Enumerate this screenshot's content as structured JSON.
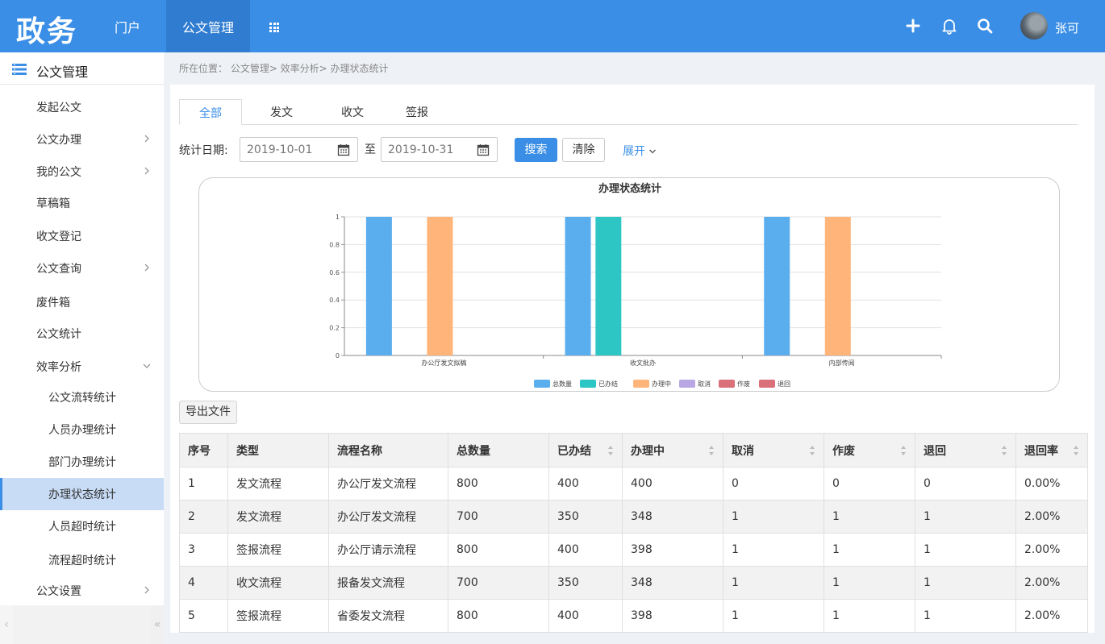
{
  "app": {
    "logo": "政务"
  },
  "nav": {
    "portal": "门户",
    "doc_mgmt": "公文管理"
  },
  "user": {
    "name": "张可"
  },
  "sidebar": {
    "header": "公文管理",
    "items": [
      {
        "label": "发起公文"
      },
      {
        "label": "公文办理"
      },
      {
        "label": "我的公文"
      },
      {
        "label": "草稿箱"
      },
      {
        "label": "收文登记"
      },
      {
        "label": "公文查询"
      },
      {
        "label": "废件箱"
      },
      {
        "label": "公文统计"
      },
      {
        "label": "效率分析"
      },
      {
        "label": "公文流转统计"
      },
      {
        "label": "人员办理统计"
      },
      {
        "label": "部门办理统计"
      },
      {
        "label": "办理状态统计"
      },
      {
        "label": "人员超时统计"
      },
      {
        "label": "流程超时统计"
      },
      {
        "label": "公文设置"
      }
    ],
    "collapse_left": "‹",
    "collapse_right": "«"
  },
  "breadcrumb": "所在位置： 公文管理>  效率分析>  办理状态统计",
  "tabs": [
    "全部",
    "发文",
    "收文",
    "签报"
  ],
  "filter": {
    "label": "统计日期:",
    "start": "2019-10-01",
    "to": "至",
    "end": "2019-10-31",
    "search": "搜索",
    "clear": "清除",
    "expand": "展开"
  },
  "export_label": "导出文件",
  "colors": {
    "accent": "#3a8ee6"
  },
  "chart_data": {
    "type": "bar",
    "title": "办理状态统计",
    "categories": [
      "办公厅发文拟稿",
      "收文批办",
      "内部传阅"
    ],
    "ylim": [
      0,
      1
    ],
    "yticks": [
      "0",
      "0.2",
      "0.4",
      "0.6",
      "0.8",
      "1"
    ],
    "grid": true,
    "legend": "bottom",
    "series": [
      {
        "name": "总数量",
        "color": "#5aaeee",
        "values": [
          1,
          1,
          1
        ]
      },
      {
        "name": "已办结",
        "color": "#2ec5c5",
        "values": [
          0,
          1,
          0
        ]
      },
      {
        "name": "办理中",
        "color": "#ffb47a",
        "values": [
          1,
          0,
          1
        ]
      },
      {
        "name": "取消",
        "color": "#b9a6e4",
        "values": [
          0,
          0,
          0
        ]
      },
      {
        "name": "作废",
        "color": "#d9707a",
        "values": [
          0,
          0,
          0
        ]
      },
      {
        "name": "退回",
        "color": "#d9707a",
        "values": [
          0,
          0,
          0
        ]
      }
    ]
  },
  "table": {
    "headers": [
      "序号",
      "类型",
      "流程名称",
      "总数量",
      "已办结",
      "办理中",
      "取消",
      "作废",
      "退回",
      "退回率"
    ],
    "rows": [
      [
        "1",
        "发文流程",
        "办公厅发文流程",
        "800",
        "400",
        "400",
        "0",
        "0",
        "0",
        "0.00%"
      ],
      [
        "2",
        "发文流程",
        "办公厅发文流程",
        "700",
        "350",
        "348",
        "1",
        "1",
        "1",
        "2.00%"
      ],
      [
        "3",
        "签报流程",
        "办公厅请示流程",
        "800",
        "400",
        "398",
        "1",
        "1",
        "1",
        "2.00%"
      ],
      [
        "4",
        "收文流程",
        "报备发文流程",
        "700",
        "350",
        "348",
        "1",
        "1",
        "1",
        "2.00%"
      ],
      [
        "5",
        "签报流程",
        "省委发文流程",
        "800",
        "400",
        "398",
        "1",
        "1",
        "1",
        "2.00%"
      ]
    ]
  }
}
